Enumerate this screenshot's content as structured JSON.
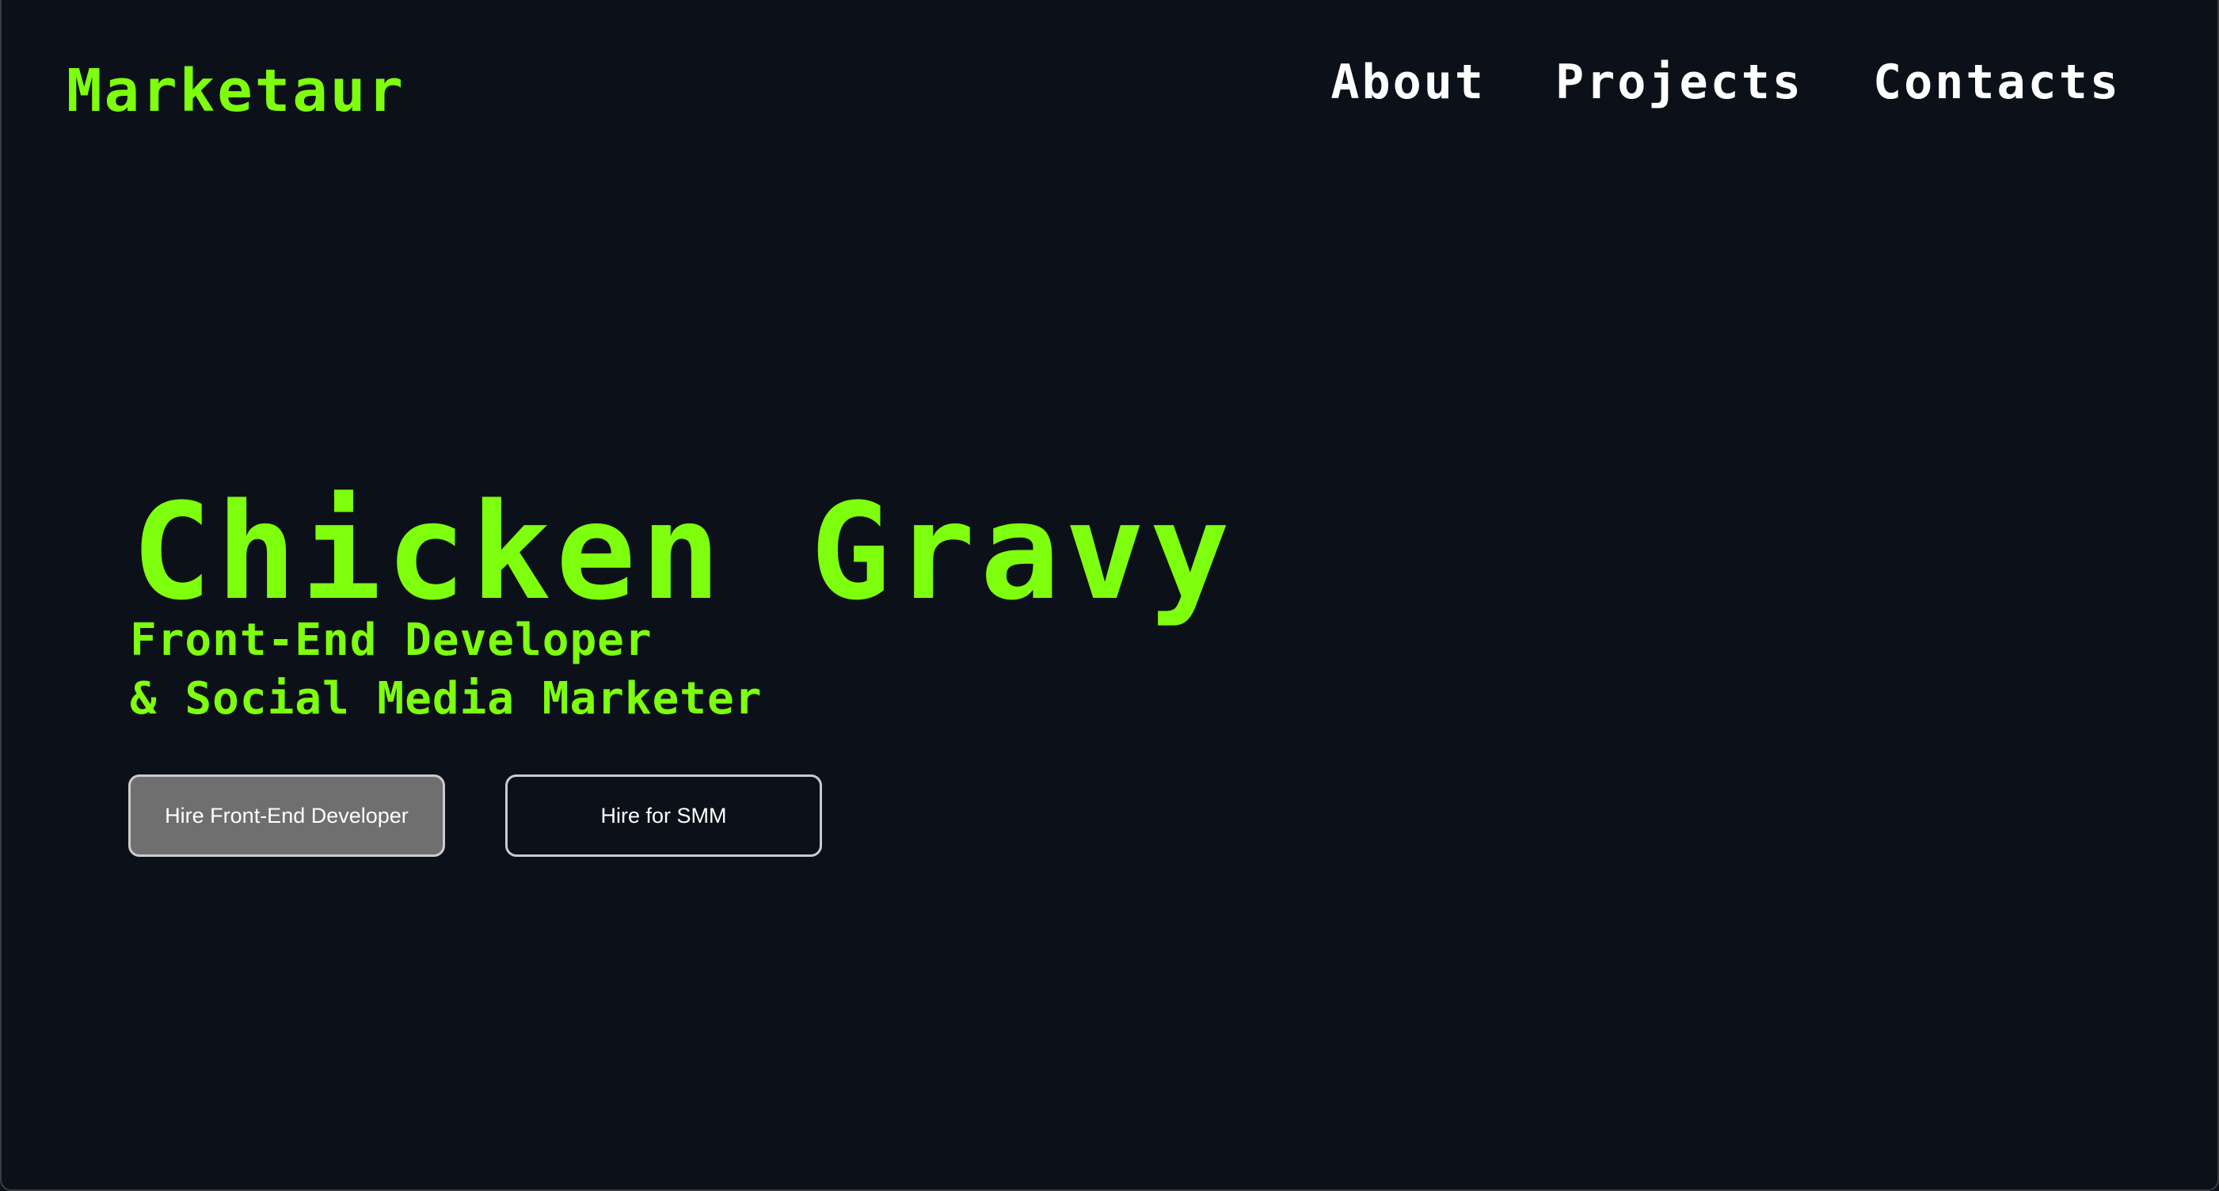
{
  "header": {
    "brand": "Marketaur",
    "nav": [
      "About",
      "Projects",
      "Contacts"
    ]
  },
  "hero": {
    "title": "Chicken Gravy",
    "subtitle_lines": [
      "Front-End Developer",
      "& Social Media Marketer"
    ],
    "buttons": [
      "Hire Front-End Developer",
      "Hire for SMM"
    ]
  },
  "colors": {
    "background": "#0c1119",
    "accent": "#7dff0d",
    "text": "#ffffff",
    "primary_button": "#6f6f6f",
    "button_border": "#c9cbcf"
  }
}
